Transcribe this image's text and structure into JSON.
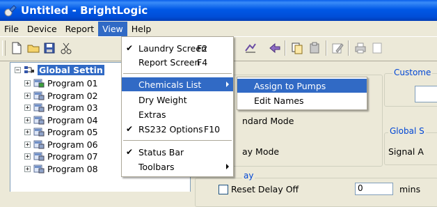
{
  "window": {
    "title": "Untitled - BrightLogic"
  },
  "menubar": [
    "File",
    "Device",
    "Report",
    "View",
    "Help"
  ],
  "view_menu": {
    "items": [
      {
        "label": "Laundry Screen",
        "shortcut": "F2",
        "checked": true
      },
      {
        "label": "Report Screen",
        "shortcut": "F4",
        "checked": false
      },
      {
        "label": "Chemicals List",
        "shortcut": "",
        "checked": false,
        "submenu": true
      },
      {
        "label": "Dry Weight",
        "shortcut": "",
        "checked": false
      },
      {
        "label": "Extras",
        "shortcut": "",
        "checked": false
      },
      {
        "label": "RS232 Options",
        "shortcut": "F10",
        "checked": true
      },
      {
        "label": "Status Bar",
        "shortcut": "",
        "checked": true
      },
      {
        "label": "Toolbars",
        "shortcut": "",
        "checked": false,
        "submenu": true
      }
    ]
  },
  "chemicals_submenu": {
    "items": [
      "Assign to Pumps",
      "Edit Names"
    ]
  },
  "tree": {
    "root": "Global Settin",
    "programs": [
      "Program 01",
      "Program 02",
      "Program 03",
      "Program 04",
      "Program 05",
      "Program 06",
      "Program 07",
      "Program 08"
    ]
  },
  "panel": {
    "customer_label": "Custome",
    "standard_mode": "ndard Mode",
    "delay_mode": "ay Mode",
    "global_label": "Global S",
    "signal_label": "Signal A",
    "delay_group_label": "ay",
    "reset_delay_label": "Reset Delay Off",
    "reset_delay_value": "0",
    "units": "mins"
  },
  "colors": {
    "titlebar": "#0054E3",
    "highlight": "#316AC5",
    "group_label": "#0046D5"
  }
}
